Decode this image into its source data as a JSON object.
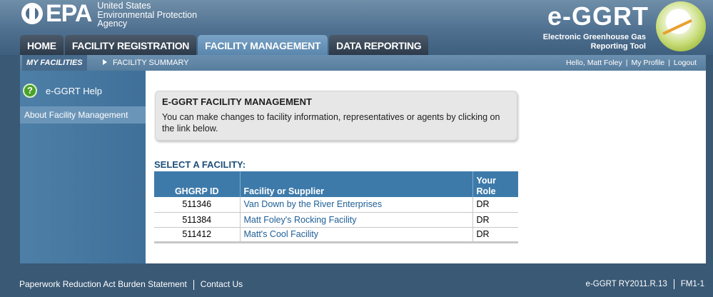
{
  "agency": {
    "logo_text": "EPA",
    "name_line1": "United States",
    "name_line2": "Environmental Protection",
    "name_line3": "Agency"
  },
  "app": {
    "title": "e-GGRT",
    "subtitle_line1": "Electronic Greenhouse Gas",
    "subtitle_line2": "Reporting Tool"
  },
  "tabs": [
    {
      "label": "HOME",
      "active": false
    },
    {
      "label": "FACILITY REGISTRATION",
      "active": false
    },
    {
      "label": "FACILITY MANAGEMENT",
      "active": true
    },
    {
      "label": "DATA REPORTING",
      "active": false
    }
  ],
  "subnav": {
    "my_facilities": "MY FACILITIES",
    "facility_summary": "FACILITY SUMMARY",
    "greeting": "Hello, Matt Foley",
    "my_profile": "My Profile",
    "logout": "Logout"
  },
  "sidebar": {
    "help_label": "e-GGRT Help",
    "help_icon": "?",
    "about_label": "About Facility Management"
  },
  "infobox": {
    "title": "E-GGRT FACILITY MANAGEMENT",
    "text": "You can make changes to facility information, representatives or agents by clicking on the link below."
  },
  "facilities": {
    "heading": "SELECT A FACILITY:",
    "columns": {
      "id": "GHGRP ID",
      "name": "Facility or Supplier",
      "role": "Your Role"
    },
    "rows": [
      {
        "id": "511346",
        "name": "Van Down by the River Enterprises",
        "role": "DR"
      },
      {
        "id": "511384",
        "name": "Matt Foley's Rocking Facility",
        "role": "DR"
      },
      {
        "id": "511412",
        "name": "Matt's Cool Facility",
        "role": "DR"
      }
    ]
  },
  "footer": {
    "burden": "Paperwork Reduction Act Burden Statement",
    "contact": "Contact Us",
    "version": "e-GGRT RY2011.R.13",
    "page_id": "FM1-1"
  },
  "colors": {
    "header_blue": "#4f7090",
    "tab_active": "#6a95bb",
    "table_header": "#3d7aaa",
    "link": "#1e5f96"
  }
}
